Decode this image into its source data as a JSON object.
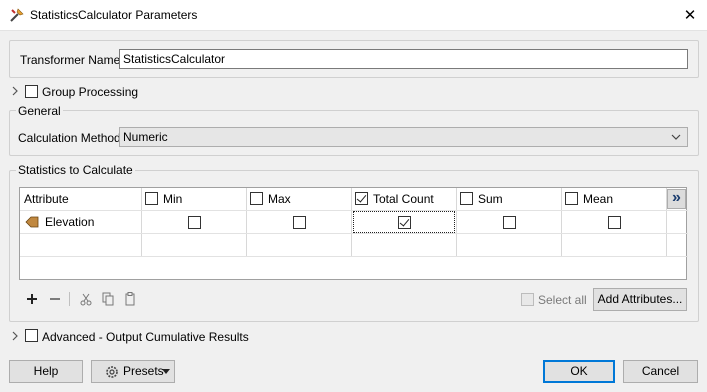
{
  "window": {
    "title": "StatisticsCalculator Parameters",
    "close_glyph": "✕"
  },
  "transformer": {
    "label": "Transformer Name:",
    "value": "StatisticsCalculator"
  },
  "group_processing": {
    "label": "Group Processing",
    "checked": false
  },
  "general": {
    "section": "General",
    "calc_method_label": "Calculation Method:",
    "calc_method_value": "Numeric"
  },
  "statistics": {
    "section": "Statistics to Calculate",
    "columns": [
      {
        "label": "Attribute"
      },
      {
        "label": "Min",
        "header_checked": false
      },
      {
        "label": "Max",
        "header_checked": false
      },
      {
        "label": "Total Count",
        "header_checked": true
      },
      {
        "label": "Sum",
        "header_checked": false
      },
      {
        "label": "Mean",
        "header_checked": false
      }
    ],
    "more_columns_glyph": "»",
    "rows": [
      {
        "attribute": "Elevation",
        "icon": "attribute-tag-icon",
        "min": false,
        "max": false,
        "total_count": true,
        "sum": false,
        "mean": false
      }
    ],
    "select_all_label": "Select all",
    "add_attributes_label": "Add Attributes..."
  },
  "advanced": {
    "label": "Advanced - Output Cumulative Results",
    "checked": false
  },
  "buttons": {
    "help": "Help",
    "presets": "Presets",
    "ok": "OK",
    "cancel": "Cancel"
  },
  "colors": {
    "ok_border": "#0078d7",
    "title_bg": "#ffffff",
    "dialog_bg": "#f0f0f0"
  }
}
